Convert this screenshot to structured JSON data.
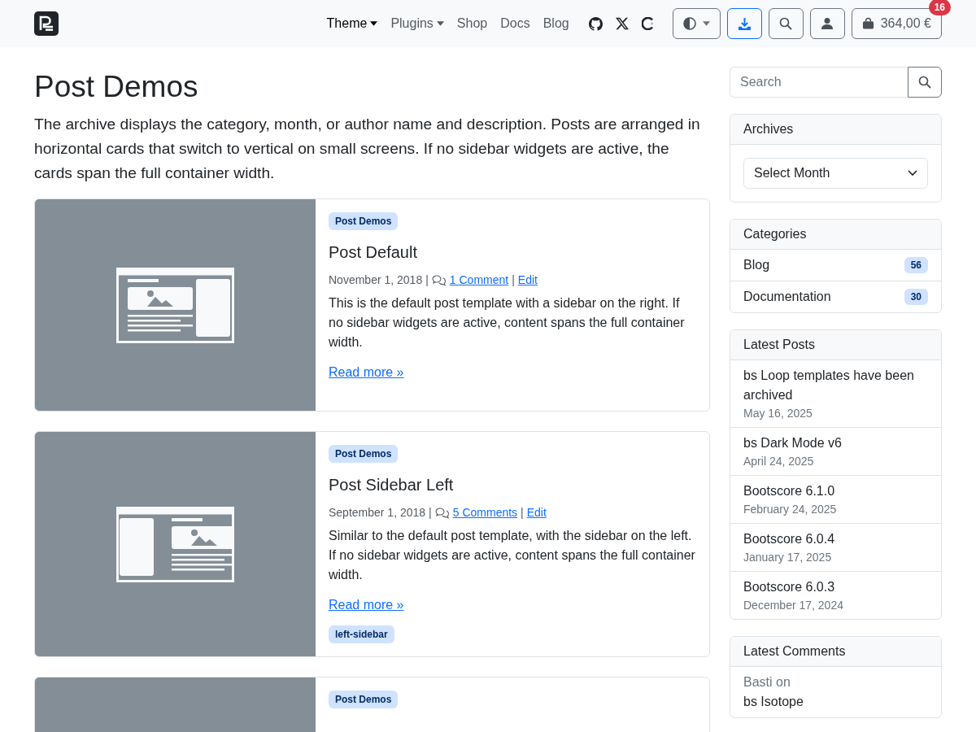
{
  "navbar": {
    "items": [
      {
        "label": "Theme",
        "active": true,
        "dropdown": true
      },
      {
        "label": "Plugins",
        "active": false,
        "dropdown": true
      },
      {
        "label": "Shop",
        "active": false,
        "dropdown": false
      },
      {
        "label": "Docs",
        "active": false,
        "dropdown": false
      },
      {
        "label": "Blog",
        "active": false,
        "dropdown": false
      }
    ],
    "social": [
      {
        "kind": "github"
      },
      {
        "kind": "x"
      },
      {
        "kind": "ring"
      }
    ],
    "buttons": [
      {
        "kind": "theme",
        "primary": false
      },
      {
        "kind": "download",
        "primary": true
      },
      {
        "kind": "search",
        "primary": false
      },
      {
        "kind": "user",
        "primary": false
      }
    ],
    "cart": {
      "total": "364,00 €",
      "count": "16"
    }
  },
  "page": {
    "title": "Post Demos",
    "description": "The archive displays the category, month, or author name and description. Posts are arranged in horizontal cards that switch to vertical on small screens. If no sidebar widgets are active, the cards span the full container width."
  },
  "posts": [
    {
      "kind": "right",
      "category": "Post Demos",
      "title": "Post Default",
      "meta": [
        {
          "kind": "date",
          "text": "November 1, 2018"
        },
        {
          "kind": "sep",
          "text": "|"
        },
        {
          "kind": "comments",
          "text": "1 Comment"
        },
        {
          "kind": "sep",
          "text": "|"
        },
        {
          "kind": "edit",
          "text": "Edit"
        }
      ],
      "excerpt": "This is the default post template with a sidebar on the right. If no sidebar widgets are active, content spans the full container width.",
      "read_more": "Read more »"
    },
    {
      "kind": "left",
      "category": "Post Demos",
      "title": "Post Sidebar Left",
      "meta": [
        {
          "kind": "date",
          "text": "September 1, 2018"
        },
        {
          "kind": "sep",
          "text": "|"
        },
        {
          "kind": "comments",
          "text": "5 Comments"
        },
        {
          "kind": "sep",
          "text": "|"
        },
        {
          "kind": "edit",
          "text": "Edit"
        }
      ],
      "excerpt": "Similar to the default post template, with the sidebar on the left. If no sidebar widgets are active, content spans the full container width.",
      "read_more": "Read more »",
      "tags": [
        "left-sidebar"
      ]
    },
    {
      "category": "Post Demos"
    }
  ],
  "sidebar": {
    "search": {
      "placeholder": "Search"
    },
    "archives": {
      "title": "Archives",
      "select": "Select Month"
    },
    "categories": {
      "title": "Categories",
      "items": [
        {
          "name": "Blog",
          "count": "56"
        },
        {
          "name": "Documentation",
          "count": "30"
        }
      ]
    },
    "latest_posts": {
      "title": "Latest Posts",
      "items": [
        {
          "title": "bs Loop templates have been archived",
          "date": "May 16, 2025"
        },
        {
          "title": "bs Dark Mode v6",
          "date": "April 24, 2025"
        },
        {
          "title": "Bootscore 6.1.0",
          "date": "February 24, 2025"
        },
        {
          "title": "Bootscore 6.0.4",
          "date": "January 17, 2025"
        },
        {
          "title": "Bootscore 6.0.3",
          "date": "December 17, 2024"
        }
      ]
    },
    "latest_comments": {
      "title": "Latest Comments",
      "items": [
        {
          "author": "Basti on",
          "post": "bs Isotope"
        }
      ]
    }
  }
}
